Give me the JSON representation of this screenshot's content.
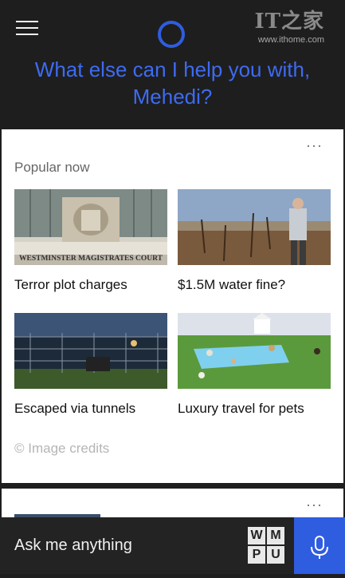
{
  "watermark": {
    "logo": "IT之家",
    "url": "www.ithome.com"
  },
  "header": {
    "greeting": "What else can I help you with, Mehedi?"
  },
  "card": {
    "more": "···",
    "section_title": "Popular now",
    "tiles": [
      {
        "caption": "Terror plot charges",
        "image_text": "WESTMINSTER MAGISTRATES COURT"
      },
      {
        "caption": "$1.5M water fine?"
      },
      {
        "caption": "Escaped via tunnels"
      },
      {
        "caption": "Luxury travel for pets"
      }
    ],
    "credits": "© Image credits"
  },
  "card2": {
    "more": "···"
  },
  "ask": {
    "placeholder": "Ask me anything"
  },
  "wmpu": [
    "W",
    "M",
    "P",
    "U"
  ],
  "colors": {
    "accent": "#2f5de0",
    "greeting": "#3d6bf2",
    "background": "#1e1e1e"
  }
}
